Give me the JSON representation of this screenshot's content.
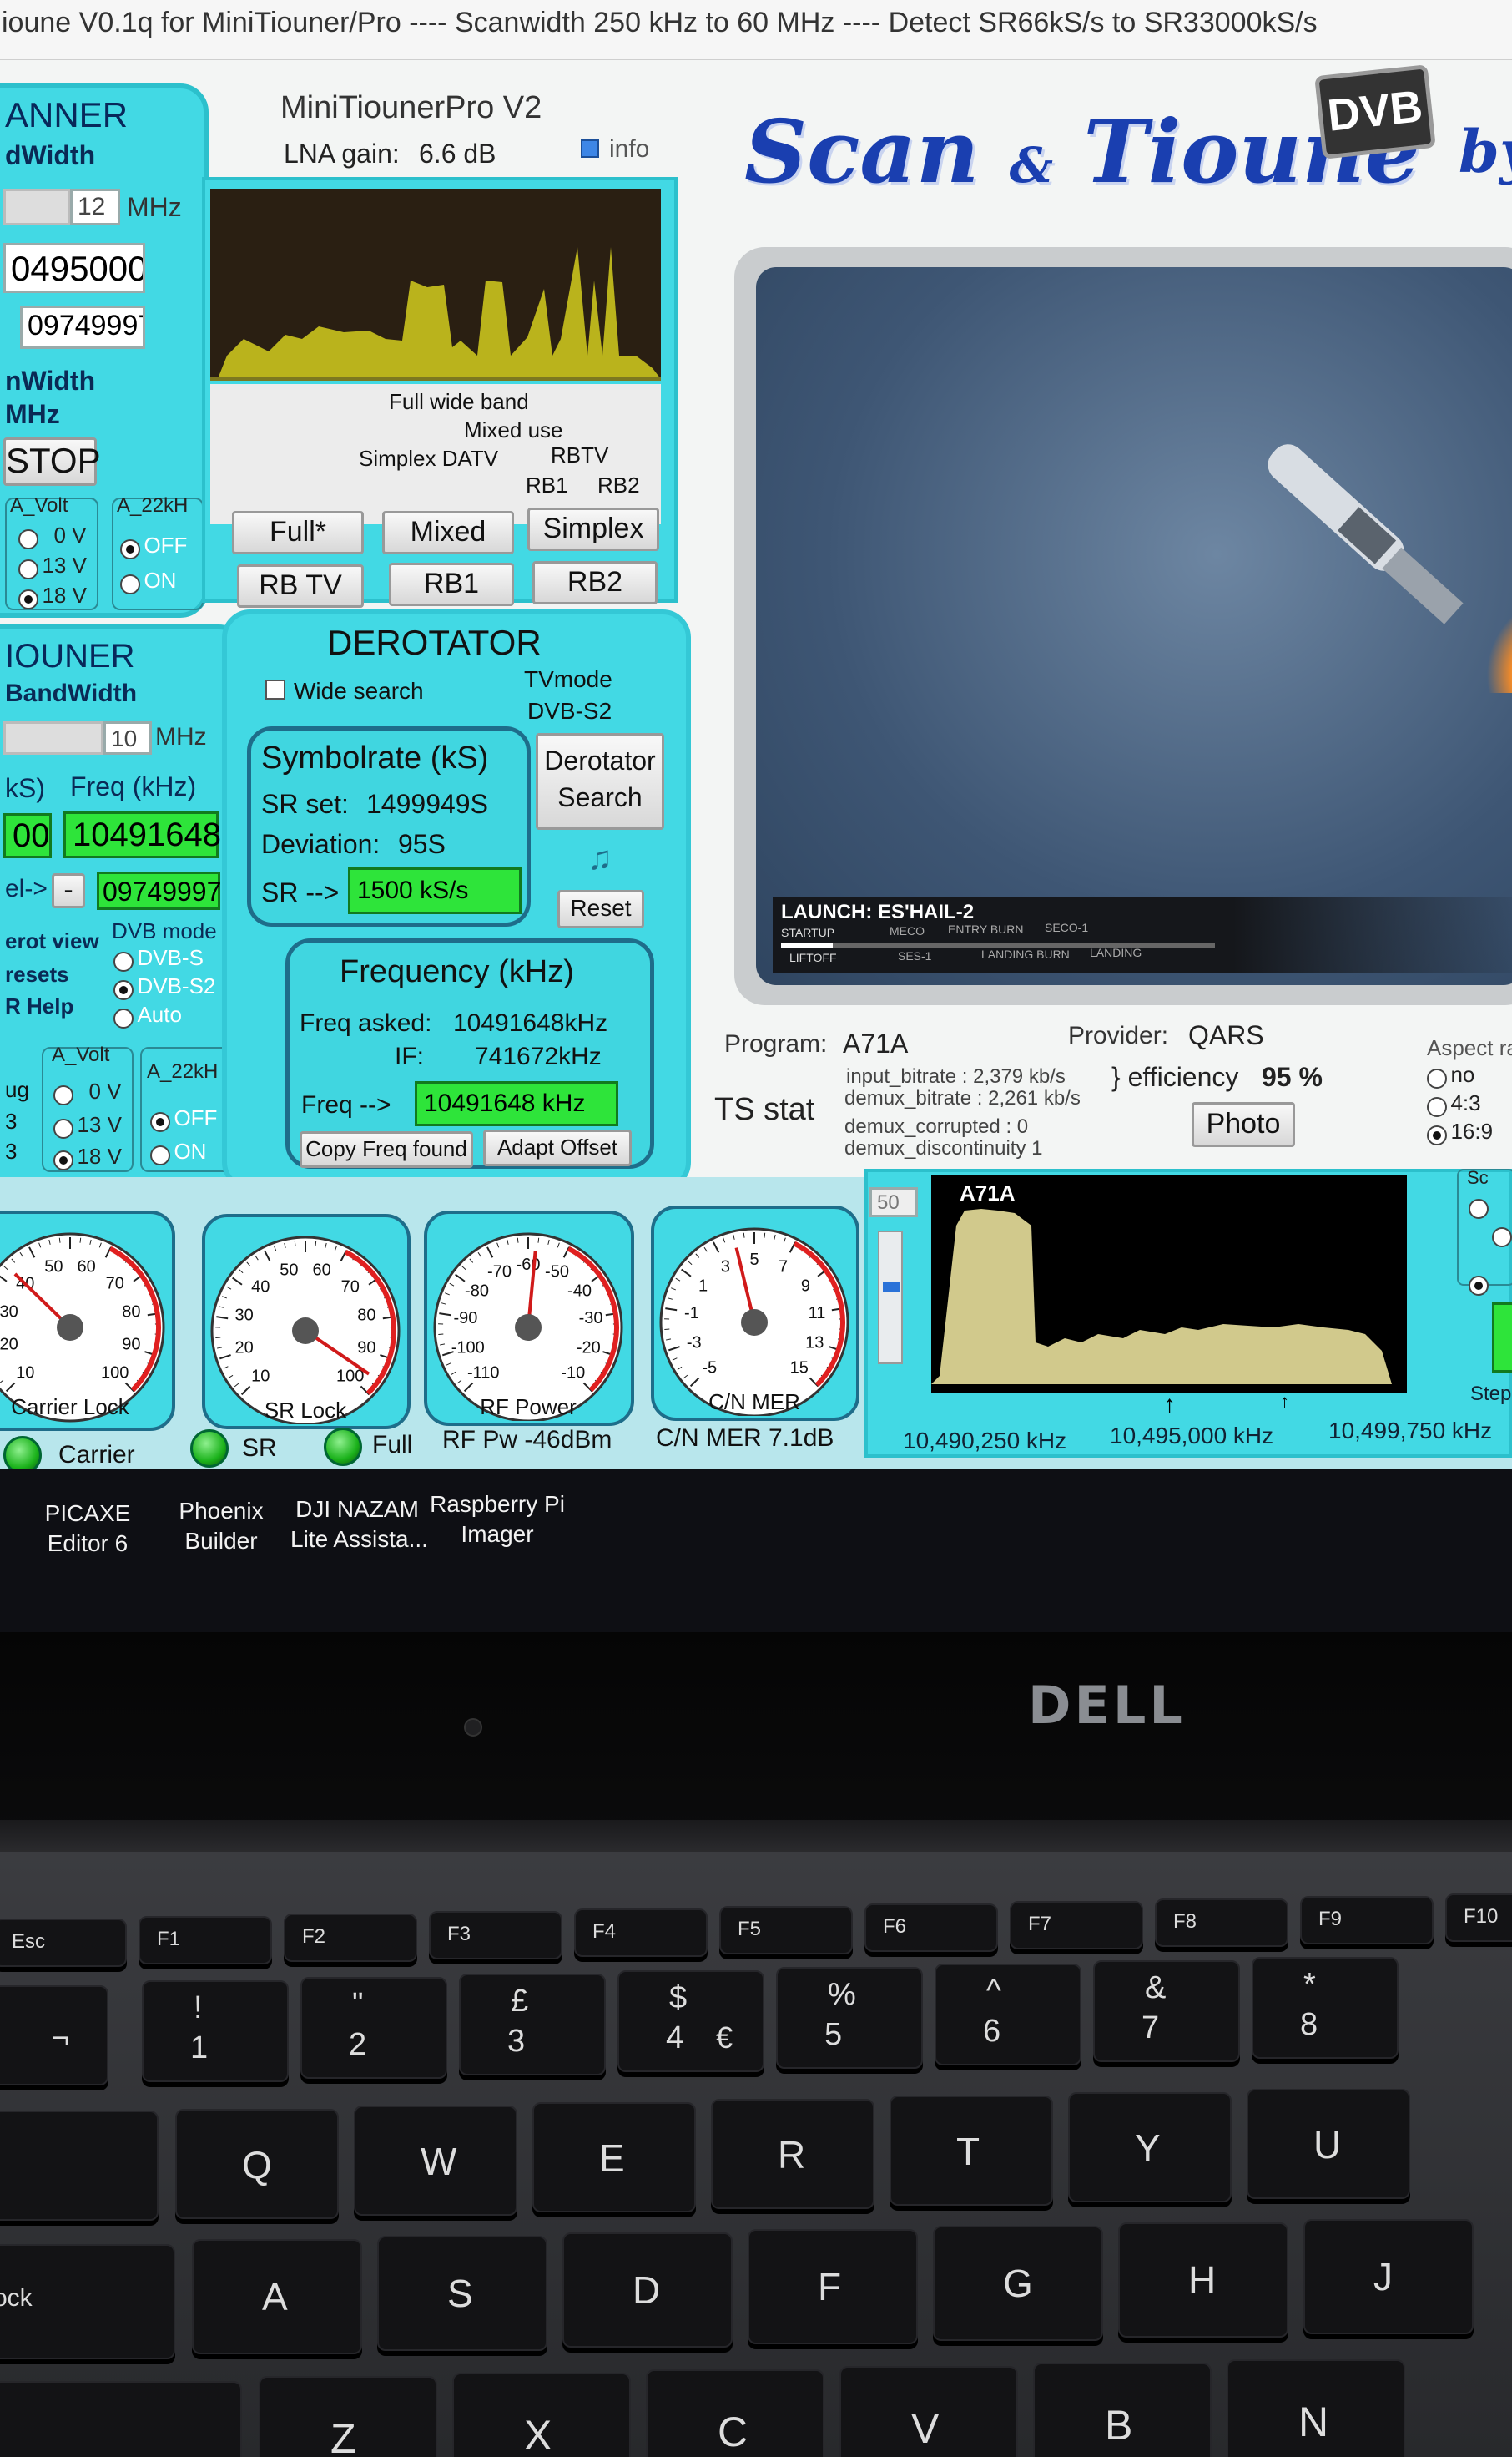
{
  "window_title": "ioune V0.1q for MiniTiouner/Pro ---- Scanwidth 250 kHz to 60 MHz ---- Detect SR66kS/s to SR33000kS/s",
  "scanner": {
    "title": "ANNER",
    "bandwidth_label": "dWidth",
    "bandwidth_value": "12",
    "mhz": "MHz",
    "freq1": "0495000",
    "freq2": "09749997",
    "scanwidth_label": "nWidth",
    "scanwidth_unit": "MHz",
    "stop_label": "STOP",
    "a_volt": "A_Volt",
    "a_22k": "A_22kH",
    "volt_options": [
      "0 V",
      "13 V",
      "18 V"
    ],
    "k22_options": [
      "OFF",
      "ON"
    ]
  },
  "device": {
    "name": "MiniTiounerPro V2",
    "lna_label": "LNA gain:",
    "lna_value": "6.6 dB",
    "info_label": "info"
  },
  "band": {
    "full_wide_band": "Full wide band",
    "mixed_use": "Mixed use",
    "simplex_datv": "Simplex DATV",
    "rbtv": "RBTV",
    "rb1": "RB1",
    "rb2": "RB2",
    "buttons": [
      "Full*",
      "Mixed",
      "Simplex",
      "RB TV",
      "RB1",
      "RB2"
    ]
  },
  "tiouner": {
    "title": "IOUNER",
    "bandwidth_label": "BandWidth",
    "bandwidth_value": "10",
    "mhz": "MHz",
    "sr_col": "kS)",
    "freq_col": "Freq (kHz)",
    "sr_value": "00",
    "freq_value": "10491648",
    "offset_label": "el->",
    "offset_sign": "-",
    "offset_value": "09749997",
    "dvb_mode": "DVB mode",
    "dvb_options": [
      "DVB-S",
      "DVB-S2",
      "Auto"
    ],
    "side_labels": [
      "erot view",
      "resets",
      "R Help"
    ],
    "bottom_labels": [
      "ug",
      "3",
      "3"
    ],
    "a_volt": "A_Volt",
    "a_22k": "A_22kH",
    "volt_options": [
      "0 V",
      "13 V",
      "18 V"
    ],
    "k22_options": [
      "OFF",
      "ON"
    ]
  },
  "derotator": {
    "title": "DEROTATOR",
    "wide_search": "Wide search",
    "tvmode_label": "TVmode",
    "tvmode_value": "DVB-S2",
    "symbolrate_title": "Symbolrate (kS)",
    "sr_set_label": "SR set:",
    "sr_set_value": "1499949S",
    "deviation_label": "Deviation:",
    "deviation_value": "95S",
    "sr_arrow": "SR -->",
    "sr_value": "1500 kS/s",
    "search_btn_1": "Derotator",
    "search_btn_2": "Search",
    "reset": "Reset",
    "freq_title": "Frequency (kHz)",
    "freq_asked_label": "Freq asked:",
    "freq_asked_value": "10491648kHz",
    "if_label": "IF:",
    "if_value": "741672kHz",
    "freq_arrow": "Freq -->",
    "freq_value": "10491648 kHz",
    "copy_btn": "Copy Freq found",
    "adapt_btn": "Adapt Offset"
  },
  "logo": {
    "text_1": "Scan",
    "amp": "&",
    "text_2": "Tioune",
    "badge": "DVB",
    "tail": "by"
  },
  "video": {
    "overlay_title": "LAUNCH: ES'HAIL-2",
    "timeline_top": [
      "STARTUP",
      "MECO",
      "ENTRY BURN",
      "SECO-1"
    ],
    "timeline_bottom": [
      "LIFTOFF",
      "SES-1",
      "LANDING BURN",
      "LANDING"
    ]
  },
  "ts": {
    "program_label": "Program:",
    "program_value": "A71A",
    "provider_label": "Provider:",
    "provider_value": "QARS",
    "stat_label": "TS stat",
    "input_bitrate": "input_bitrate : 2,379 kb/s",
    "demux_bitrate": "demux_bitrate : 2,261 kb/s",
    "demux_corrupted": "demux_corrupted : 0",
    "demux_discontinuity": "demux_discontinuity 1",
    "efficiency_label": "} efficiency",
    "efficiency_value": "95 %",
    "photo": "Photo",
    "aspect_label": "Aspect ra",
    "aspect_options": [
      "no",
      "4:3",
      "16:9"
    ]
  },
  "gauges": [
    {
      "name": "Carrier Lock",
      "ticks": [
        "10",
        "20",
        "30",
        "40",
        "50",
        "60",
        "70",
        "80",
        "90",
        "100"
      ],
      "needle_fraction": 0.33
    },
    {
      "name": "SR Lock",
      "ticks": [
        "10",
        "20",
        "30",
        "40",
        "50",
        "60",
        "70",
        "80",
        "90",
        "100"
      ],
      "needle_fraction": 0.96
    },
    {
      "name": "RF Power",
      "ticks": [
        "-110",
        "-100",
        "-90",
        "-80",
        "-70",
        "-60",
        "-50",
        "-40",
        "-30",
        "-20",
        "-10"
      ],
      "needle_fraction": 0.52
    },
    {
      "name": "C/N MER",
      "ticks": [
        "-5",
        "-3",
        "-1",
        "1",
        "3",
        "5",
        "7",
        "9",
        "11",
        "13",
        "15"
      ],
      "needle_fraction": 0.45
    }
  ],
  "status": {
    "carrier": "Carrier",
    "sr": "SR",
    "full": "Full",
    "rf_pw": "RF Pw  -46dBm",
    "cn_mer": "C/N MER  7.1dB"
  },
  "spectrum": {
    "label": "A71A",
    "level": "50",
    "freq_left": "10,490,250 kHz",
    "freq_mid": "10,495,000 kHz",
    "freq_right": "10,499,750 kHz",
    "step": "Step:",
    "sc": "Sc"
  },
  "desktop_icons": [
    {
      "line1": "PICAXE",
      "line2": "Editor 6"
    },
    {
      "line1": "Phoenix",
      "line2": "Builder"
    },
    {
      "line1": "DJI NAZAM",
      "line2": "Lite Assista..."
    },
    {
      "line1": "Raspberry Pi",
      "line2": "Imager"
    }
  ],
  "laptop_brand": "DELL",
  "keyboard": {
    "fn_row": [
      "Esc",
      "F1",
      "F2",
      "F3",
      "F4",
      "F5",
      "F6",
      "F7",
      "F8",
      "F9",
      "F10"
    ],
    "num_row": [
      {
        "top": "!",
        "bottom": "1"
      },
      {
        "top": "\"",
        "bottom": "2"
      },
      {
        "top": "£",
        "bottom": "3"
      },
      {
        "top": "$",
        "bottom": "4",
        "alt": "€"
      },
      {
        "top": "%",
        "bottom": "5"
      },
      {
        "top": "^",
        "bottom": "6"
      },
      {
        "top": "&",
        "bottom": "7"
      },
      {
        "top": "*",
        "bottom": "8"
      }
    ],
    "row_q": [
      "Q",
      "W",
      "E",
      "R",
      "T",
      "Y",
      "U"
    ],
    "row_a": [
      "A",
      "S",
      "D",
      "F",
      "G",
      "H",
      "J"
    ],
    "row_z": [
      "Z",
      "X",
      "C",
      "V",
      "B",
      "N"
    ],
    "caps": "ock",
    "backtick": "¬"
  },
  "colors": {
    "panel": "#42d9e4",
    "accent_green": "#2ee43a",
    "logo_blue": "#1a3fb0"
  }
}
